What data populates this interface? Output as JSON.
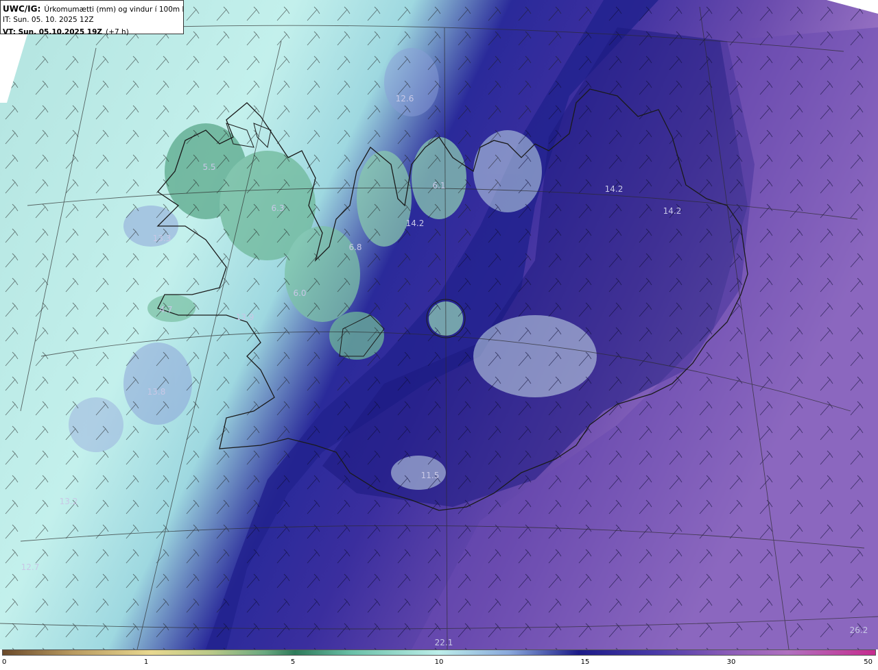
{
  "header": {
    "product": "UWC/IG:",
    "variable": "Úrkomumætti (mm) og vindur í 100m hæð",
    "it_line": "IT: Sun. 05. 10. 2025 12Z",
    "vt_prefix": "VT: Sun. 05.10.2025 19Z",
    "vt_suffix": "(+7 h)"
  },
  "map": {
    "region": "Iceland",
    "value_labels": [
      {
        "text": "5.5"
      },
      {
        "text": "6.3"
      },
      {
        "text": "13.3"
      },
      {
        "text": "4.7"
      },
      {
        "text": "6.0"
      },
      {
        "text": "6.8"
      },
      {
        "text": "13.9"
      },
      {
        "text": "12.6"
      },
      {
        "text": "6.1"
      },
      {
        "text": "14.2"
      },
      {
        "text": "14.2"
      },
      {
        "text": "14.2"
      },
      {
        "text": "13.8"
      },
      {
        "text": "13.2"
      },
      {
        "text": "12.7"
      },
      {
        "text": "11.5"
      },
      {
        "text": "22.1"
      },
      {
        "text": "26.2"
      }
    ],
    "colors": {
      "dry": "#6b4a2a",
      "low": "#e8d890",
      "mid_green": "#2e7a5a",
      "light_cyan": "#bdeeea",
      "dark_blue": "#1c1a88",
      "purple": "#8a5cb8",
      "magenta": "#c62c8f"
    }
  },
  "colorbar": {
    "ticks": [
      "0",
      "1",
      "5",
      "10",
      "15",
      "30",
      "50"
    ],
    "tick_values": [
      0,
      1,
      5,
      10,
      15,
      30,
      50
    ]
  }
}
